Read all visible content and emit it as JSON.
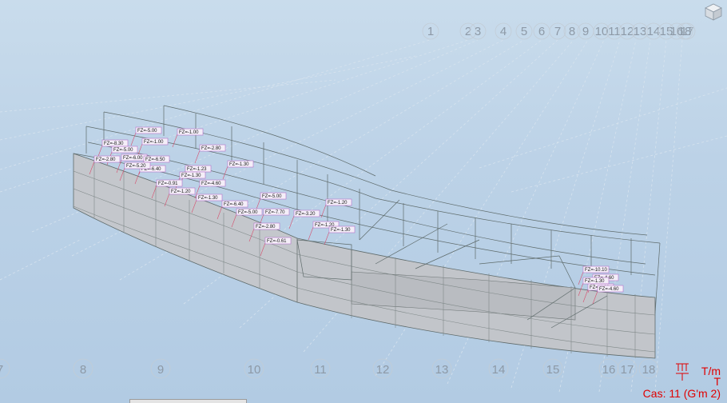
{
  "grid_top": [
    "1",
    "2",
    "3",
    "4",
    "5",
    "6",
    "7",
    "8",
    "9",
    "10",
    "11",
    "12",
    "13",
    "14",
    "15",
    "16",
    "17",
    "18"
  ],
  "grid_bottom": [
    "7",
    "8",
    "9",
    "10",
    "11",
    "12",
    "13",
    "14",
    "15",
    "16",
    "17",
    "18"
  ],
  "loads_left": [
    "FZ=-5.00",
    "FZ=-1.00",
    "FZ=-8.30",
    "FZ=-1.00",
    "FZ=-5.00",
    "FZ=-2.80",
    "FZ=-6.00",
    "FZ=-6.50",
    "FZ=-2.80",
    "FZ=-1.23",
    "FZ=-1.30",
    "FZ=-6.40",
    "FZ=-5.20",
    "FZ=-1.30",
    "FZ=-0.91",
    "FZ=-4.60",
    "FZ=-1.20",
    "FZ=-1.30",
    "FZ=-5.00",
    "FZ=-1.20",
    "FZ=-6.40",
    "FZ=-5.00",
    "FZ=-7.70",
    "FZ=-3.20",
    "FZ=-1.20",
    "FZ=-1.30",
    "FZ=-2.80",
    "FZ=-0.61"
  ],
  "loads_right": [
    "FZ=-10.10",
    "FZ=-4.60",
    "FZ=-1.30",
    "FZ=-4.60",
    "FZ=-4.60"
  ],
  "legend": {
    "unit_line": "T/m",
    "unit_force": "T",
    "case_label": "Cas: 11 (G'm 2)"
  },
  "colors": {
    "structure_fill": "#c4c7cc",
    "edge": "#5e6a6a",
    "load_line": "#d64a6a",
    "label_border": "#b270c8",
    "legend": "#e00000"
  }
}
